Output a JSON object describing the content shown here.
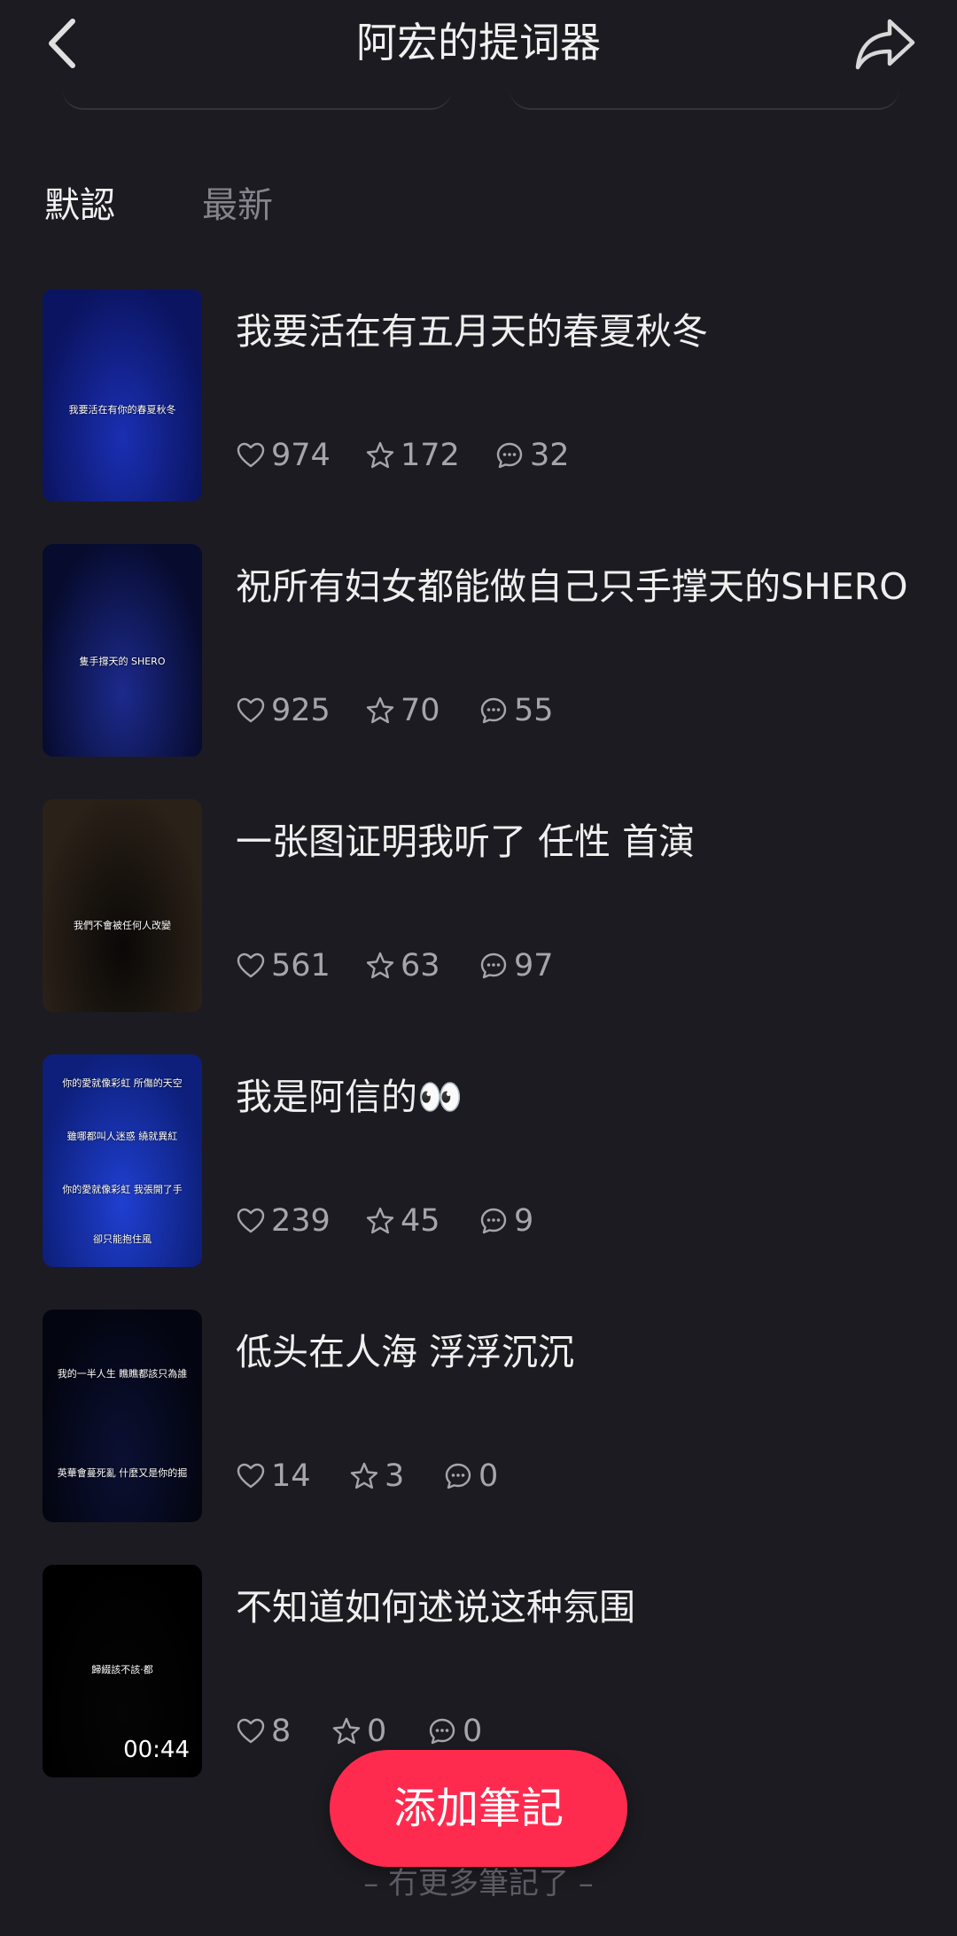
{
  "header": {
    "title": "阿宏的提词器",
    "back_icon": "chevron-left-icon",
    "share_icon": "share-arrow-icon"
  },
  "tabs": [
    {
      "label": "默認",
      "active": true
    },
    {
      "label": "最新",
      "active": false
    }
  ],
  "notes": [
    {
      "title": "我要活在有五月天的春夏秋冬",
      "likes": "974",
      "stars": "172",
      "comments": "32",
      "thumb_captions": [
        "我要活在有你的春夏秋冬"
      ],
      "thumb_colors": [
        "#0b1460",
        "#1a2fb3"
      ]
    },
    {
      "title": "祝所有妇女都能做自己只手撑天的SHERO",
      "likes": "925",
      "stars": "70",
      "comments": "55",
      "thumb_captions": [
        "隻手撐天的 SHERO"
      ],
      "thumb_colors": [
        "#070b2e",
        "#1c2a8c"
      ]
    },
    {
      "title": "一张图证明我听了 任性 首演",
      "likes": "561",
      "stars": "63",
      "comments": "97",
      "thumb_captions": [
        "我們不會被任何人改變"
      ],
      "thumb_colors": [
        "#2a2118",
        "#0a0806"
      ]
    },
    {
      "title": "我是阿信的👀",
      "likes": "239",
      "stars": "45",
      "comments": "9",
      "thumb_captions": [
        "你的愛就像彩虹 所傷的天空",
        "雖哪都叫人迷惑 繞就異紅",
        "你的愛就像彩虹 我張開了手",
        "卻只能抱住風"
      ],
      "thumb_colors": [
        "#0d1f7a",
        "#1f3fd0"
      ]
    },
    {
      "title": "低头在人海 浮浮沉沉",
      "likes": "14",
      "stars": "3",
      "comments": "0",
      "thumb_captions": [
        "我的一半人生 瞧瞧都該只為誰",
        "英華會蔓死亂 什麼又是你的掘"
      ],
      "thumb_colors": [
        "#030510",
        "#0b1033"
      ]
    },
    {
      "title": "不知道如何述说这种氛围",
      "likes": "8",
      "stars": "0",
      "comments": "0",
      "thumb_captions": [
        "歸綴該不該‧都"
      ],
      "thumb_colors": [
        "#000000",
        "#050505"
      ],
      "duration": "00:44"
    }
  ],
  "stat_icons": {
    "like": "heart-icon",
    "star": "star-icon",
    "comment": "comment-icon"
  },
  "add_button": {
    "label": "添加筆記",
    "color": "#ff2b4f"
  },
  "footer": {
    "text": "– 冇更多筆記了 –"
  },
  "colors": {
    "background": "#1c1b21",
    "text": "#ececec",
    "muted": "#a6a5ac",
    "accent": "#ff2b4f"
  }
}
